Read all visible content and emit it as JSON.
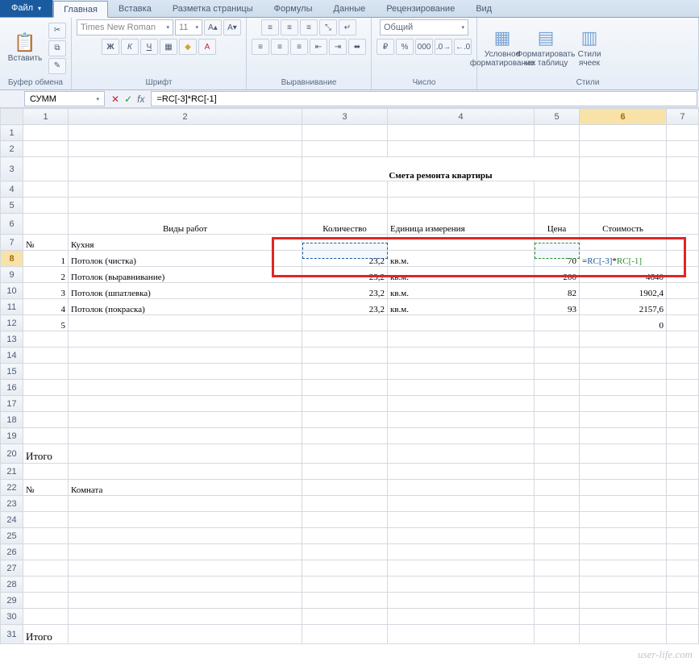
{
  "tabs": {
    "file": "Файл",
    "items": [
      "Главная",
      "Вставка",
      "Разметка страницы",
      "Формулы",
      "Данные",
      "Рецензирование",
      "Вид"
    ],
    "active": 0
  },
  "ribbon": {
    "clipboard": {
      "label": "Буфер обмена",
      "paste": "Вставить"
    },
    "font": {
      "label": "Шрифт",
      "name": "Times New Roman",
      "size": "11"
    },
    "align": {
      "label": "Выравнивание"
    },
    "number": {
      "label": "Число",
      "format": "Общий"
    },
    "styles": {
      "label": "Стили",
      "cond": "Условное форматирование",
      "table": "Форматировать как таблицу",
      "cell": "Стили ячеек"
    }
  },
  "formulabar": {
    "name": "СУММ",
    "formula": "=RC[-3]*RC[-1]"
  },
  "columns": [
    "1",
    "2",
    "3",
    "4",
    "5",
    "6",
    "7"
  ],
  "rows_visible": 31,
  "cells": {
    "title": "Смета ремонта квартиры",
    "headers": {
      "num": "№",
      "types": "Виды работ",
      "qty": "Количество",
      "unit": "Единица измерения",
      "price": "Цена",
      "cost": "Стоимость"
    },
    "r7": {
      "num": "№",
      "name": "Кухня"
    },
    "data": [
      {
        "row": 8,
        "n": "1",
        "name": "Потолок (чистка)",
        "qty": "23,2",
        "unit": "кв.м.",
        "price": "70",
        "cost_formula": {
          "pre": "=",
          "a": "RC[-3]",
          "mid": "*",
          "b": "RC[-1]"
        }
      },
      {
        "row": 9,
        "n": "2",
        "name": "Потолок (выравнивание)",
        "qty": "23,2",
        "unit": "кв.м.",
        "price": "200",
        "cost": "4640"
      },
      {
        "row": 10,
        "n": "3",
        "name": "Потолок (шпатлевка)",
        "qty": "23,2",
        "unit": "кв.м.",
        "price": "82",
        "cost": "1902,4"
      },
      {
        "row": 11,
        "n": "4",
        "name": "Потолок (покраска)",
        "qty": "23,2",
        "unit": "кв.м.",
        "price": "93",
        "cost": "2157,6"
      },
      {
        "row": 12,
        "n": "5",
        "name": "",
        "qty": "",
        "unit": "",
        "price": "",
        "cost": "0"
      }
    ],
    "r20": "Итого",
    "r22": {
      "num": "№",
      "name": "Комната"
    },
    "r31": "Итого"
  },
  "watermark": "user-life.com"
}
